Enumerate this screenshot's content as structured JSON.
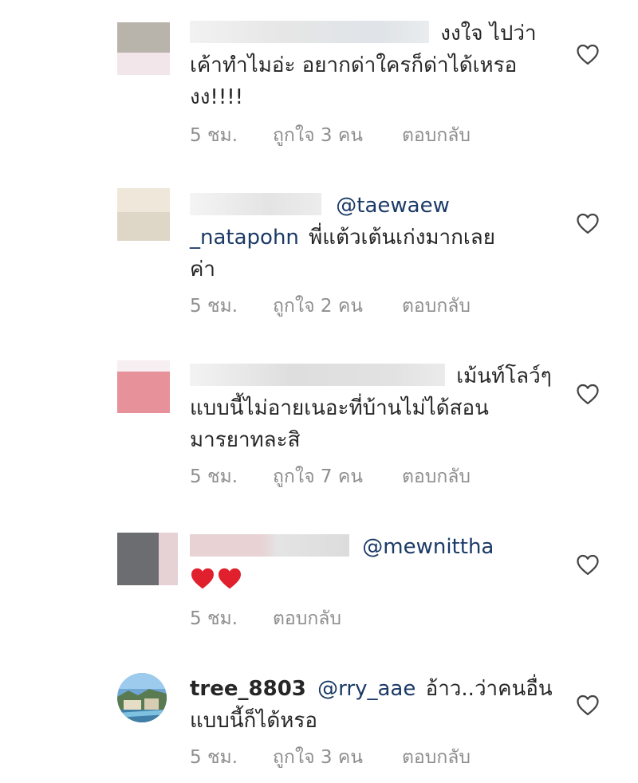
{
  "comments": [
    {
      "text_lines": [
        "งงใจ ไปว่า",
        "เค้าทำไมอ่ะ อยากด่าใครก็ด่าได้เหรอ",
        "งง!!!!"
      ],
      "time": "5 ชม.",
      "likes": "ถูกใจ 3 คน",
      "reply": "ตอบกลับ"
    },
    {
      "mention": "@taewaew",
      "mention_cont": "_natapohn",
      "text_lines": [
        "พี่แต้วเต้นเก่งมากเลย",
        "ค่า"
      ],
      "time": "5 ชม.",
      "likes": "ถูกใจ 2 คน",
      "reply": "ตอบกลับ"
    },
    {
      "text_lines": [
        "เม้นท์โลว์ๆ",
        "แบบนี้ไม่อายเนอะที่บ้านไม่ได้สอน",
        "มารยาทละสิ"
      ],
      "time": "5 ชม.",
      "likes": "ถูกใจ 7 คน",
      "reply": "ตอบกลับ"
    },
    {
      "mention": "@mewnittha",
      "emoji": "❤❤",
      "time": "5 ชม.",
      "reply": "ตอบกลับ"
    },
    {
      "username": "tree_8803",
      "mention": "@rry_aae",
      "text_lines": [
        "อ้าว..ว่าคนอื่น",
        "แบบนี้ก็ได้หรอ"
      ],
      "time": "5 ชม.",
      "likes": "ถูกใจ 3 คน",
      "reply": "ตอบกลับ"
    }
  ],
  "icons": {
    "like": "heart-outline-icon",
    "emoji": "red-heart-emoji"
  },
  "colors": {
    "mention": "#1b3a66",
    "meta": "#8e8e8e",
    "text": "#262626"
  }
}
